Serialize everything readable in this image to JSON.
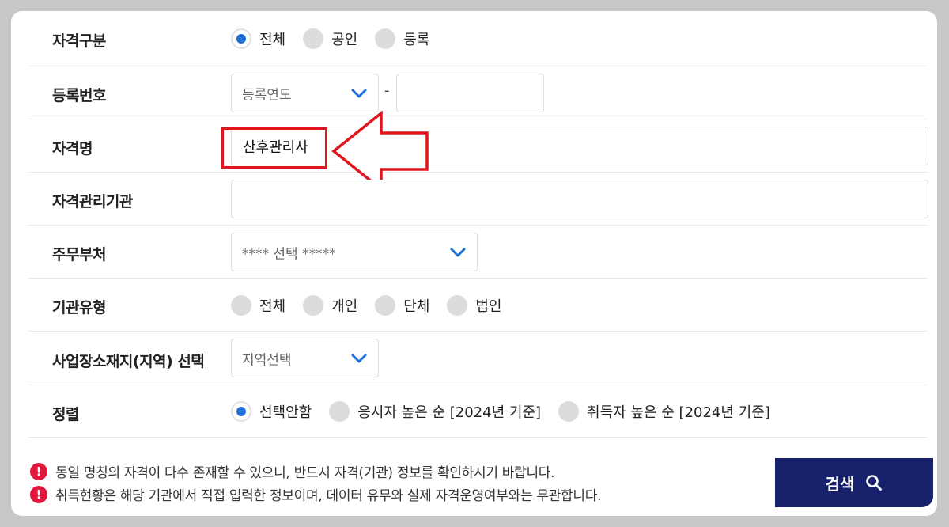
{
  "form": {
    "qual_type": {
      "label": "자격구분",
      "options": [
        "전체",
        "공인",
        "등록"
      ],
      "selected": "전체"
    },
    "reg_number": {
      "label": "등록번호",
      "year_select": "등록연도",
      "separator": "-",
      "number_value": ""
    },
    "qual_name": {
      "label": "자격명",
      "value": "산후관리사"
    },
    "agency": {
      "label": "자격관리기관",
      "value": ""
    },
    "ministry": {
      "label": "주무부처",
      "select": "**** 선택 *****"
    },
    "org_type": {
      "label": "기관유형",
      "options": [
        "전체",
        "개인",
        "단체",
        "법인"
      ],
      "selected": ""
    },
    "region": {
      "label": "사업장소재지(지역) 선택",
      "select": "지역선택"
    },
    "sort": {
      "label": "정렬",
      "options": [
        "선택안함",
        "응시자 높은 순 [2024년 기준]",
        "취득자 높은 순 [2024년 기준]"
      ],
      "selected": "선택안함"
    }
  },
  "notices": [
    "동일 명칭의 자격이 다수 존재할 수 있으니, 반드시 자격(기관) 정보를 확인하시기 바랍니다.",
    "취득현황은 해당 기관에서 직접 입력한 정보이며, 데이터 유무와 실제 자격운영여부와는 무관합니다."
  ],
  "notice_icon": "!",
  "search_button": {
    "label": "검색",
    "icon": "search-icon"
  },
  "colors": {
    "radio_checked": "#1f6fd8",
    "chevron": "#1f6fd8",
    "search_button_bg": "#16206b",
    "highlight": "#e0161e",
    "warning": "#e0163c"
  }
}
